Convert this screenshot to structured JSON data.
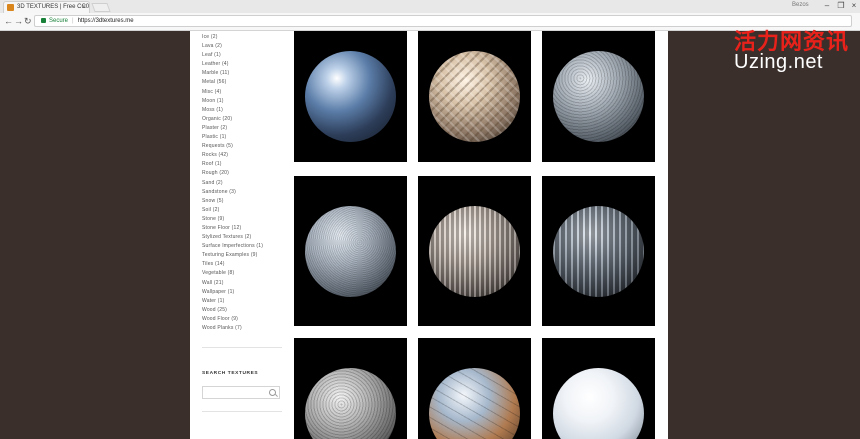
{
  "browser": {
    "tab_title": "3D TEXTURES | Free CC0",
    "tab_close": "×",
    "user_name": "Bezos",
    "win_minimize": "–",
    "win_restore": "❐",
    "win_close": "×",
    "nav_back": "←",
    "nav_forward": "→",
    "nav_reload": "↻",
    "secure_label": "Secure",
    "separator": "|",
    "url": "https://3dtextures.me"
  },
  "sidebar": {
    "categories": [
      "Ice (2)",
      "Lava (2)",
      "Leaf (1)",
      "Leather (4)",
      "Marble (11)",
      "Metal (56)",
      "Misc (4)",
      "Moon (1)",
      "Moss (1)",
      "Organic (20)",
      "Plaster (2)",
      "Plastic (1)",
      "Requests (5)",
      "Rocks (42)",
      "Roof (1)",
      "Rough (20)",
      "Sand (2)",
      "Sandstone (3)",
      "Snow (5)",
      "Soil (2)",
      "Stone (9)",
      "Stone Floor (12)",
      "Stylized Textures (2)",
      "Surface Imperfections (1)",
      "Texturing Examples (9)",
      "Tiles (14)",
      "Vegetable (8)",
      "Wall (21)",
      "Wallpaper (1)",
      "Water (1)",
      "Wood (25)",
      "Wood Floor (9)",
      "Wood Planks (7)"
    ],
    "search_heading": "SEARCH TEXTURES",
    "search_placeholder": ""
  },
  "textures": [
    {
      "icon": "glass-sphere"
    },
    {
      "icon": "diamond-plate-sphere"
    },
    {
      "icon": "rough-stone-sphere"
    },
    {
      "icon": "gravel-sphere"
    },
    {
      "icon": "corrugated-metal-sphere"
    },
    {
      "icon": "ribbed-metal-sphere"
    },
    {
      "icon": "crumpled-metal-sphere"
    },
    {
      "icon": "rusty-metal-sphere"
    },
    {
      "icon": "snow-sphere"
    }
  ],
  "watermark": {
    "chinese": "活力网资讯",
    "site": "Uzing.net",
    "color": "#e8221b"
  },
  "colors": {
    "background": "#3a2f2b",
    "secure": "#188038"
  }
}
